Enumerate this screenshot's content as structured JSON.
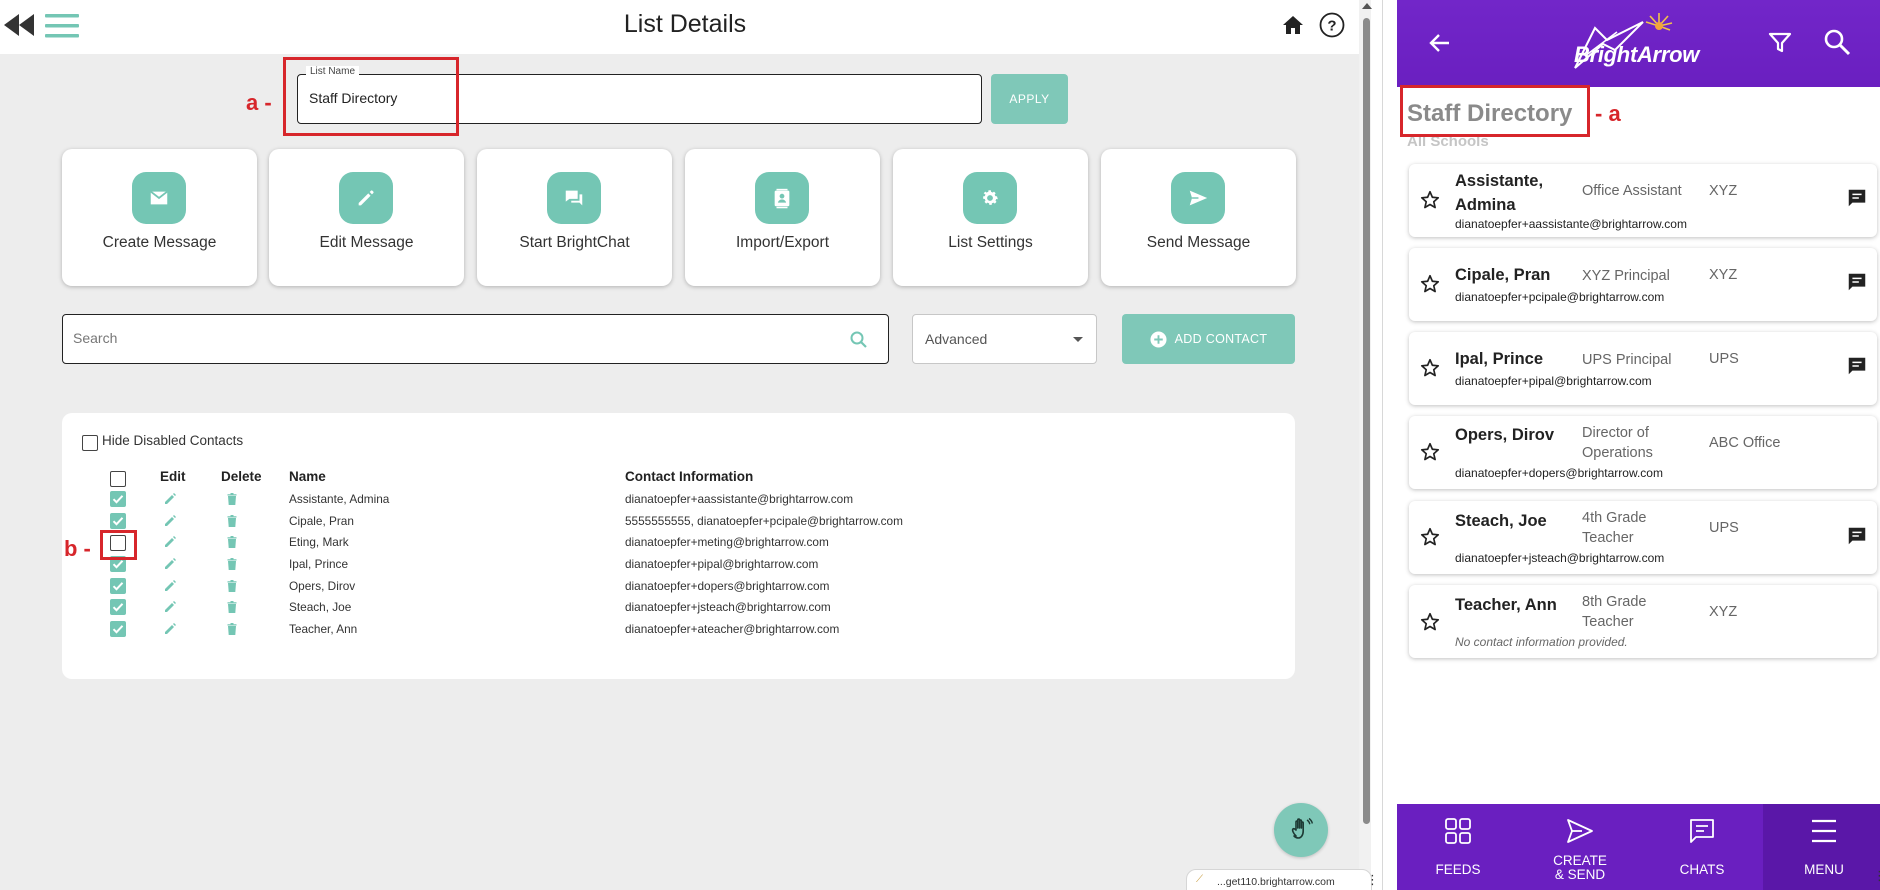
{
  "app": {
    "page_title": "List Details",
    "list_name_label": "List Name",
    "list_name_value": "Staff Directory",
    "apply_label": "APPLY"
  },
  "actions": [
    {
      "label": "Create Message",
      "icon": "mail-icon"
    },
    {
      "label": "Edit Message",
      "icon": "pencil-icon"
    },
    {
      "label": "Start BrightChat",
      "icon": "chat-bubbles-icon"
    },
    {
      "label": "Import/Export",
      "icon": "contact-card-icon"
    },
    {
      "label": "List Settings",
      "icon": "gear-icon"
    },
    {
      "label": "Send Message",
      "icon": "send-icon"
    }
  ],
  "search": {
    "placeholder": "Search",
    "advanced_label": "Advanced",
    "add_contact_label": "ADD CONTACT"
  },
  "table": {
    "hide_disabled_label": "Hide Disabled Contacts",
    "hide_disabled_checked": false,
    "headers": {
      "edit": "Edit",
      "delete": "Delete",
      "name": "Name",
      "contact": "Contact Information"
    },
    "rows": [
      {
        "checked": true,
        "name": "Assistante, Admina",
        "contact": "dianatoepfer+aassistante@brightarrow.com"
      },
      {
        "checked": true,
        "name": "Cipale, Pran",
        "contact": "5555555555, dianatoepfer+pcipale@brightarrow.com"
      },
      {
        "checked": false,
        "name": "Eting, Mark",
        "contact": "dianatoepfer+meting@brightarrow.com"
      },
      {
        "checked": true,
        "name": "Ipal, Prince",
        "contact": "dianatoepfer+pipal@brightarrow.com"
      },
      {
        "checked": true,
        "name": "Opers, Dirov",
        "contact": "dianatoepfer+dopers@brightarrow.com"
      },
      {
        "checked": true,
        "name": "Steach, Joe",
        "contact": "dianatoepfer+jsteach@brightarrow.com"
      },
      {
        "checked": true,
        "name": "Teacher, Ann",
        "contact": "dianatoepfer+ateacher@brightarrow.com"
      }
    ]
  },
  "annotations": {
    "a_left": "a -",
    "b_left": "b -",
    "a_right": "- a"
  },
  "browser": {
    "url_fragment": "...get110.brightarrow.com"
  },
  "mobile": {
    "brand": "BrightArrow",
    "list_title": "Staff Directory",
    "list_subtitle": "All Schools",
    "contacts": [
      {
        "name": "Assistante, Admina",
        "role": "Office Assistant",
        "org": "XYZ",
        "email": "dianatoepfer+aassistante@brightarrow.com",
        "has_chat": true
      },
      {
        "name": "Cipale, Pran",
        "role": "XYZ Principal",
        "org": "XYZ",
        "email": "dianatoepfer+pcipale@brightarrow.com",
        "has_chat": true
      },
      {
        "name": "Ipal, Prince",
        "role": "UPS Principal",
        "org": "UPS",
        "email": "dianatoepfer+pipal@brightarrow.com",
        "has_chat": true
      },
      {
        "name": "Opers, Dirov",
        "role": "Director of Operations",
        "org": "ABC Office",
        "email": "dianatoepfer+dopers@brightarrow.com",
        "has_chat": false
      },
      {
        "name": "Steach, Joe",
        "role": "4th Grade Teacher",
        "org": "UPS",
        "email": "dianatoepfer+jsteach@brightarrow.com",
        "has_chat": true
      },
      {
        "name": "Teacher, Ann",
        "role": "8th Grade Teacher",
        "org": "XYZ",
        "email": "No contact information provided.",
        "has_chat": false
      }
    ],
    "nav": [
      {
        "label": "FEEDS",
        "icon": "grid-icon"
      },
      {
        "label": "CREATE & SEND",
        "icon": "send-icon"
      },
      {
        "label": "CHATS",
        "icon": "chat-icon"
      },
      {
        "label": "MENU",
        "icon": "menu-icon",
        "active": true
      }
    ]
  },
  "colors": {
    "accent": "#74c6b4",
    "brand_purple": "#6a1fc0",
    "annotation_red": "#d7262b"
  }
}
